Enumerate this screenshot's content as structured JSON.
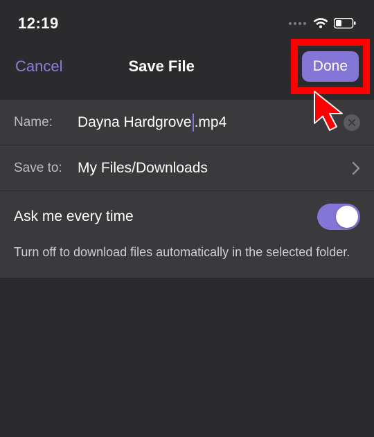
{
  "status": {
    "time": "12:19"
  },
  "header": {
    "cancel_label": "Cancel",
    "title": "Save File",
    "done_label": "Done"
  },
  "name_row": {
    "label": "Name:",
    "value_pre_caret": "Dayna Hardgrove",
    "value_post_caret": ".mp4"
  },
  "saveto_row": {
    "label": "Save to:",
    "value": "My Files/Downloads"
  },
  "toggle_row": {
    "label": "Ask me every time",
    "state": "on"
  },
  "helper_text": "Turn off to download files automatically in the selected folder."
}
